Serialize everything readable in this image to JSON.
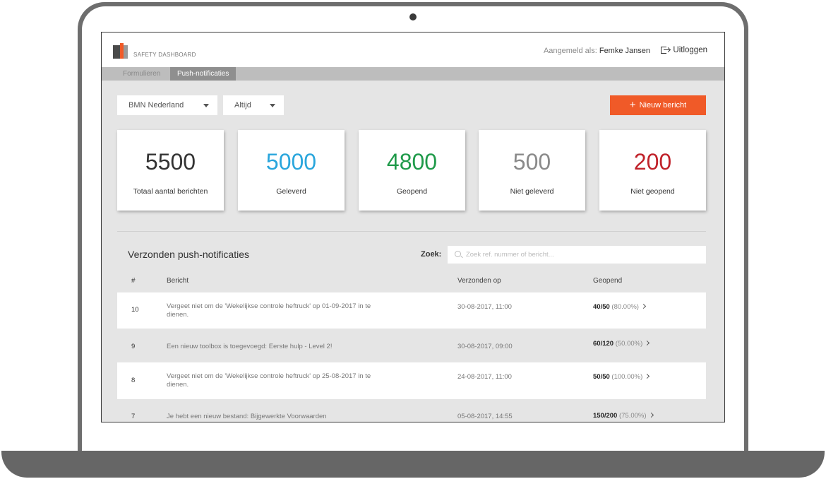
{
  "header": {
    "brand": "SAFETY DASHBOARD",
    "signed_in_label": "Aangemeld als:",
    "user_name": "Femke Jansen",
    "logout_label": "Uitloggen"
  },
  "tabs": [
    {
      "label": "Formulieren"
    },
    {
      "label": "Push-notificaties"
    }
  ],
  "filters": {
    "organization": "BMN Nederland",
    "period": "Altijd"
  },
  "new_button_label": "Nieuw bericht",
  "stats": [
    {
      "value": "5500",
      "label": "Totaal aantal berichten",
      "color": "#333333"
    },
    {
      "value": "5000",
      "label": "Geleverd",
      "color": "#2aa6dc"
    },
    {
      "value": "4800",
      "label": "Geopend",
      "color": "#1f9a4a"
    },
    {
      "value": "500",
      "label": "Niet geleverd",
      "color": "#8a8a8a"
    },
    {
      "value": "200",
      "label": "Niet geopend",
      "color": "#c0222a"
    }
  ],
  "table": {
    "title": "Verzonden push-notificaties",
    "search_label": "Zoek:",
    "search_placeholder": "Zoek ref. nummer of bericht...",
    "columns": [
      "#",
      "Bericht",
      "Verzonden op",
      "Geopend"
    ],
    "rows": [
      {
        "id": "10",
        "message": "Vergeet niet om de 'Wekelijkse controle heftruck' op 01-09-2017 in te dienen.",
        "sent": "30-08-2017, 11:00",
        "opened": "40/50",
        "percent": "(80.00%)"
      },
      {
        "id": "9",
        "message": "Een nieuw toolbox is toegevoegd: Eerste hulp - Level 2!",
        "sent": "30-08-2017, 09:00",
        "opened": "60/120",
        "percent": "(50.00%)"
      },
      {
        "id": "8",
        "message": "Vergeet niet om de 'Wekelijkse controle heftruck' op 25-08-2017 in te dienen.",
        "sent": "24-08-2017, 11:00",
        "opened": "50/50",
        "percent": "(100.00%)"
      },
      {
        "id": "7",
        "message": "Je hebt een nieuw bestand: Bijgewerkte Voorwaarden",
        "sent": "05-08-2017, 14:55",
        "opened": "150/200",
        "percent": "(75.00%)"
      }
    ]
  }
}
